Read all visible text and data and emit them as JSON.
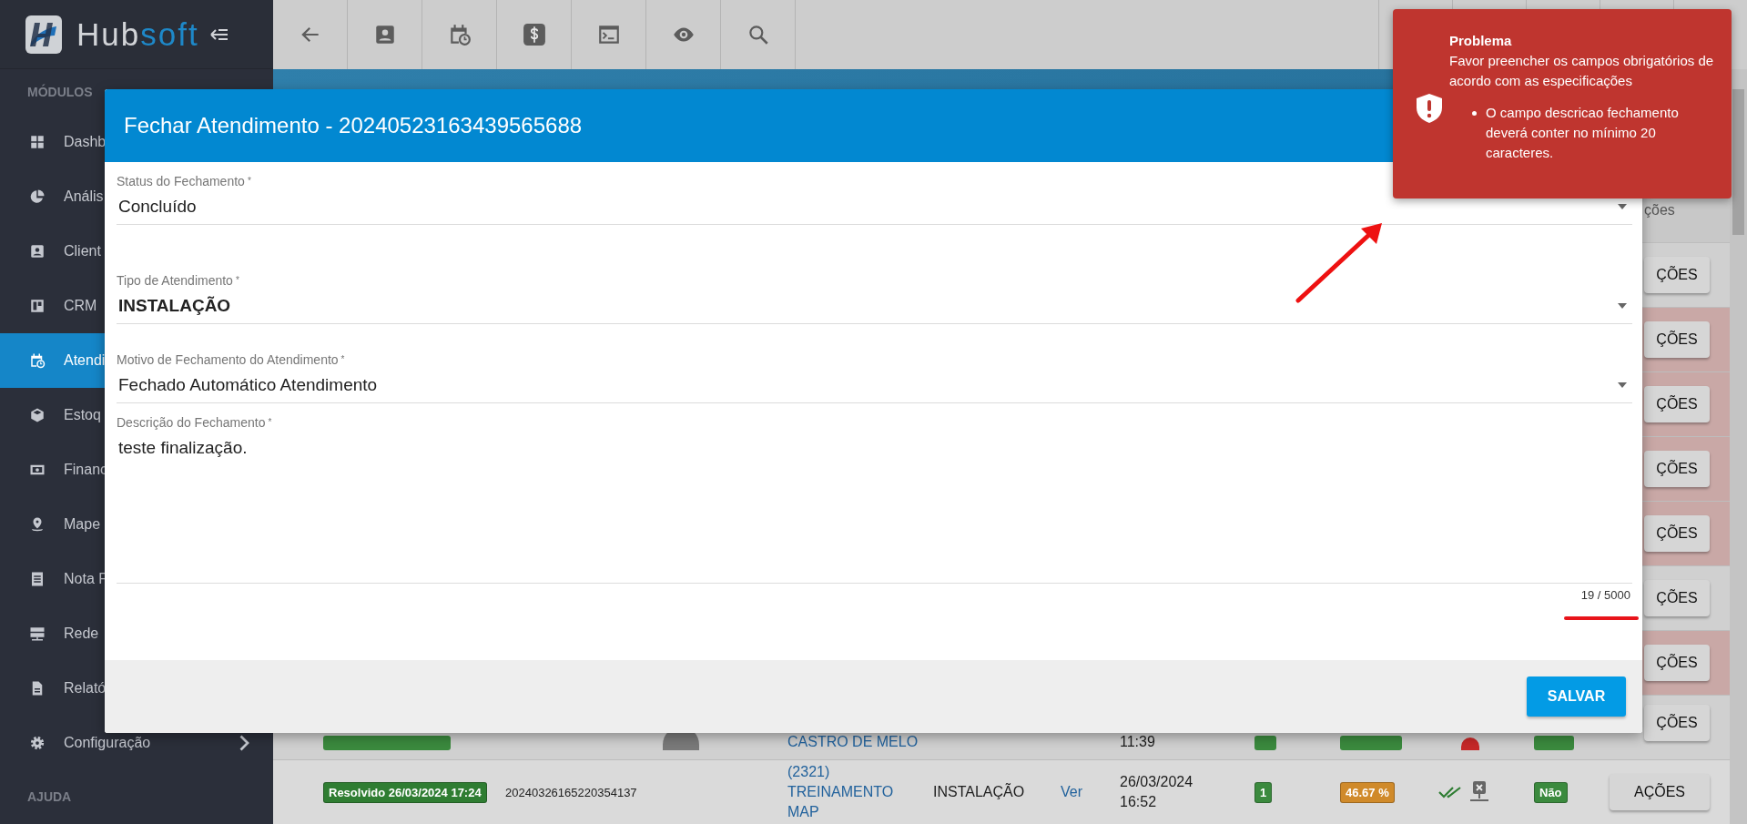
{
  "sidebar": {
    "logo": {
      "prefix": "Hub",
      "suffix": "soft"
    },
    "section_title": "MÓDULOS",
    "items": [
      {
        "label": "Dashb",
        "selected": false
      },
      {
        "label": "Anális",
        "selected": false
      },
      {
        "label": "Client",
        "selected": false
      },
      {
        "label": "CRM",
        "selected": false
      },
      {
        "label": "Atendi",
        "selected": true
      },
      {
        "label": "Estoq",
        "selected": false
      },
      {
        "label": "Financ",
        "selected": false
      },
      {
        "label": "Mape",
        "selected": false
      },
      {
        "label": "Nota F",
        "selected": false
      },
      {
        "label": "Rede",
        "selected": false
      },
      {
        "label": "Relató",
        "selected": false
      },
      {
        "label": "Configuração",
        "selected": false,
        "expandable": true
      }
    ],
    "help_title": "AJUDA"
  },
  "table": {
    "header": "ções",
    "rows": [
      {
        "kind": "hidden",
        "alert": false,
        "actions": "ÇÕES"
      },
      {
        "kind": "hidden",
        "alert": true,
        "actions": "ÇÕES"
      },
      {
        "kind": "hidden",
        "alert": true,
        "actions": "ÇÕES"
      },
      {
        "kind": "hidden",
        "alert": true,
        "actions": "ÇÕES"
      },
      {
        "kind": "hidden",
        "alert": true,
        "actions": "ÇÕES"
      },
      {
        "kind": "hidden",
        "alert": false,
        "actions": "ÇÕES"
      },
      {
        "kind": "hidden",
        "alert": true,
        "actions": "ÇÕES"
      },
      {
        "kind": "partial",
        "alert": false,
        "status": {
          "color": "#3b8a3e"
        },
        "client": "CASTRO DE MELO",
        "date": "11:39",
        "count": {
          "color": "#3b8a3e"
        },
        "percent": {
          "color": "#3b8a3e"
        },
        "dot": {
          "color": "#c62828"
        },
        "reply": {
          "color": "#3b8a3e"
        },
        "actions": "ÇÕES"
      },
      {
        "kind": "full",
        "alert": false,
        "status": {
          "text": "Resolvido 26/03/2024 17:24",
          "color": "#2f7d32"
        },
        "protocol": "20240326165220354137",
        "client": "(2321) TREINAMENTO MAP",
        "type": "INSTALAÇÃO",
        "view": "Ver",
        "date": "26/03/2024 16:52",
        "count": {
          "text": "1",
          "color": "#3b8a3e"
        },
        "percent": {
          "text": "46.67 %",
          "color": "#d08a2a"
        },
        "reply": {
          "text": "Não",
          "color": "#3b8a3e"
        },
        "actions": "AÇÕES"
      }
    ]
  },
  "dialog": {
    "title": "Fechar Atendimento - 20240523163439565688",
    "fields": [
      {
        "kind": "select",
        "label": "Status do Fechamento",
        "required_mark": "*",
        "value": "Concluído",
        "bold": false
      },
      {
        "kind": "select",
        "label": "Tipo de Atendimento",
        "required_mark": "*",
        "value": "INSTALAÇÃO",
        "bold": true
      },
      {
        "kind": "select",
        "label": "Motivo de Fechamento do Atendimento",
        "required_mark": "*",
        "value": "Fechado Automático Atendimento",
        "bold": false
      },
      {
        "kind": "textarea",
        "label": "Descrição do Fechamento",
        "required_mark": "*",
        "value": "teste finalização.",
        "counter": "19 / 5000",
        "bold": false
      }
    ],
    "save_button": "SALVAR"
  },
  "toast": {
    "title": "Problema",
    "message": "Favor preencher os campos obrigatórios de acordo com as especificações",
    "errors": [
      "O campo descricao fechamento deverá conter no mínimo 20 caracteres."
    ]
  }
}
